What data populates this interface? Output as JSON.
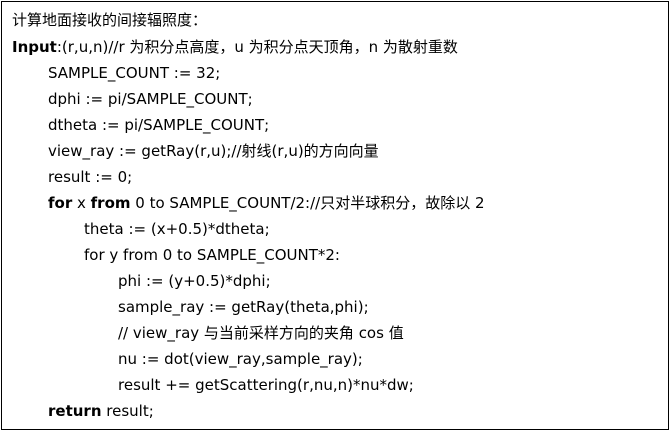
{
  "algorithm": {
    "title": "计算地面接收的间接辐照度：",
    "input_keyword": "Input",
    "input_text": ":(r,u,n)//r 为积分点高度，u 为积分点天顶角，n 为散射重数",
    "lines": {
      "l1": "SAMPLE_COUNT := 32;",
      "l2": "dphi := pi/SAMPLE_COUNT;",
      "l3": "dtheta := pi/SAMPLE_COUNT;",
      "l4": "view_ray := getRay(r,u);//射线(r,u)的方向向量",
      "l5": "result := 0;",
      "l6_kw1": "for",
      "l6_a": " x ",
      "l6_kw2": "from",
      "l6_b": " 0 to SAMPLE_COUNT/2://只对半球积分，故除以 2",
      "l7": "theta := (x+0.5)*dtheta;",
      "l8": "for y from 0 to SAMPLE_COUNT*2:",
      "l9": "phi := (y+0.5)*dphi;",
      "l10": "sample_ray := getRay(theta,phi);",
      "l11": "// view_ray 与当前采样方向的夹角 cos 值",
      "l12": "nu := dot(view_ray,sample_ray);",
      "l13": "result += getScattering(r,nu,n)*nu*dw;",
      "l14_kw": "return",
      "l14_text": " result;"
    }
  }
}
